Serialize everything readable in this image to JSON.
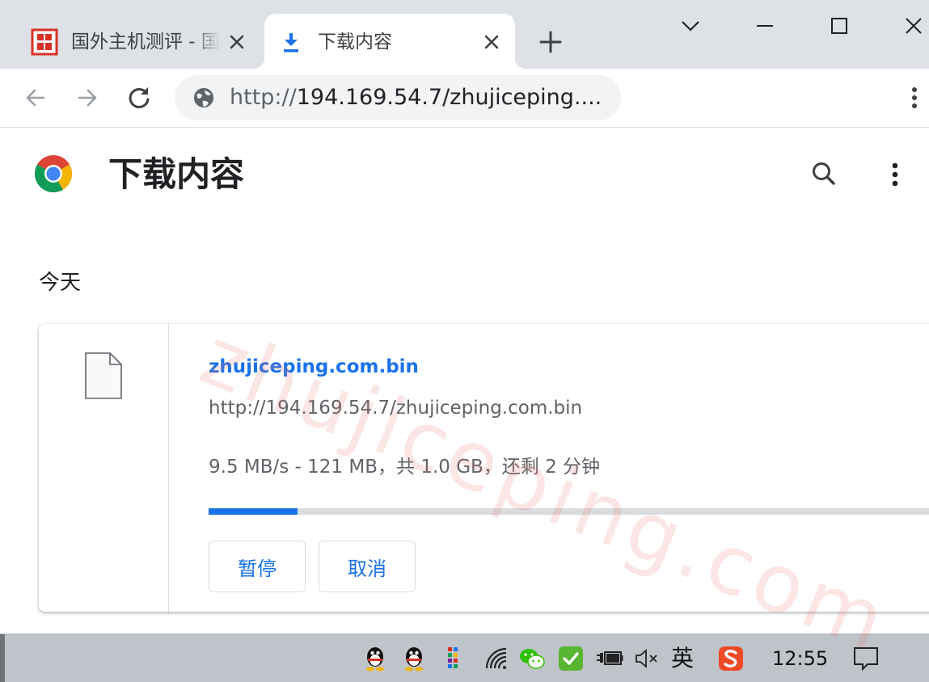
{
  "browser": {
    "tabs": [
      {
        "title": "国外主机测评 - 国外VPS，国外",
        "active": false,
        "favicon": "site-seal-icon"
      },
      {
        "title": "下载内容",
        "active": true,
        "favicon": "download-arrow-icon"
      }
    ],
    "address_bar": {
      "url_scheme": "http://",
      "url_rest": "194.169.54.7/zhujiceping...."
    }
  },
  "page": {
    "title": "下载内容",
    "watermark": "zhujiceping.com",
    "section_label": "今天"
  },
  "download": {
    "file_name": "zhujiceping.com.bin",
    "source_url": "http://194.169.54.7/zhujiceping.com.bin",
    "status": "9.5 MB/s - 121 MB，共 1.0 GB，还剩 2 分钟",
    "progress_fraction": 0.121,
    "pause_label": "暂停",
    "cancel_label": "取消"
  },
  "taskbar": {
    "ime_label": "英",
    "clock": "12:55"
  },
  "colors": {
    "accent": "#1a73e8",
    "tabstrip": "#dee1e6",
    "omnibox": "#f1f3f4",
    "watermark": "#f06e6e",
    "taskbar": "#bfc3ca"
  }
}
